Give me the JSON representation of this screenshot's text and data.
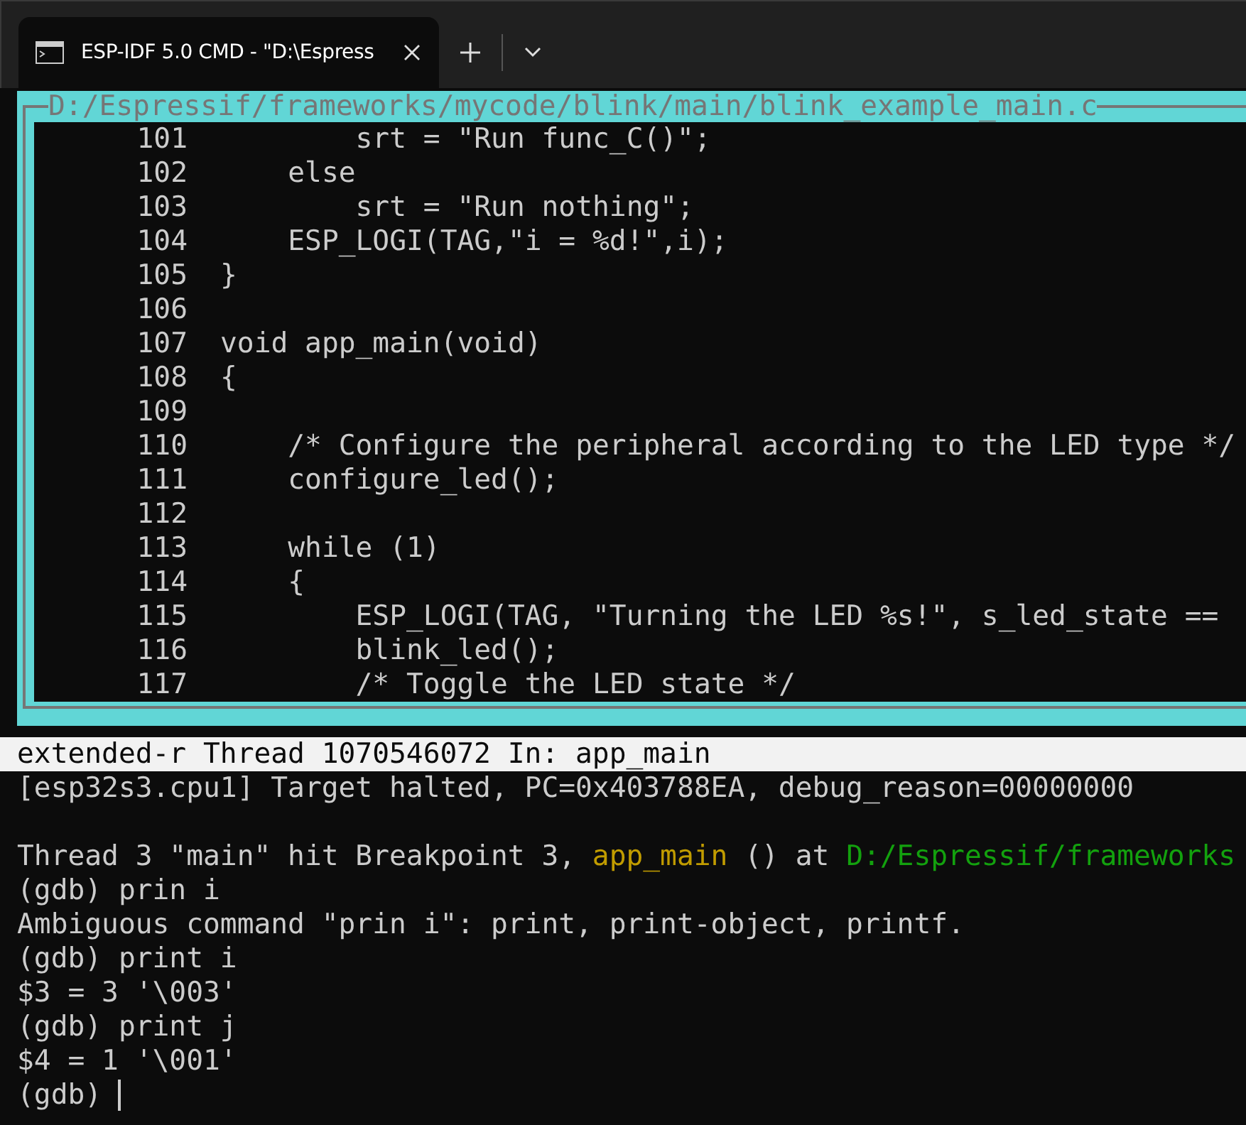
{
  "tab": {
    "title": "ESP-IDF 5.0 CMD - \"D:\\Espress",
    "selected": true
  },
  "editor": {
    "file_path": "D:/Espressif/frameworks/mycode/blink/main/blink_example_main.c",
    "lines": [
      {
        "number": "101",
        "code": "        srt = \"Run func_C()\";"
      },
      {
        "number": "102",
        "code": "    else"
      },
      {
        "number": "103",
        "code": "        srt = \"Run nothing\";"
      },
      {
        "number": "104",
        "code": "    ESP_LOGI(TAG,\"i = %d!\",i);"
      },
      {
        "number": "105",
        "code": "}"
      },
      {
        "number": "106"
      },
      {
        "number": "107",
        "code": "void app_main(void)"
      },
      {
        "number": "108",
        "code": "{"
      },
      {
        "number": "109"
      },
      {
        "number": "110",
        "code": "    /* Configure the peripheral according to the LED type */"
      },
      {
        "number": "111",
        "code": "    configure_led();"
      },
      {
        "number": "112"
      },
      {
        "number": "113",
        "code": "    while (1)"
      },
      {
        "number": "114",
        "code": "    {"
      },
      {
        "number": "115",
        "code": "        ESP_LOGI(TAG, \"Turning the LED %s!\", s_led_state =="
      },
      {
        "number": "116",
        "code": "        blink_led();"
      },
      {
        "number": "117",
        "code": "        /* Toggle the LED state */"
      }
    ]
  },
  "status_line": "extended-r Thread 1070546072 In: app_main",
  "output": [
    {
      "segments": [
        {
          "kind": "plain",
          "text": "[esp32s3.cpu1] Target halted, PC=0x403788EA, debug_reason=00000000"
        }
      ]
    },
    {
      "kind": "blank"
    },
    {
      "segments": [
        {
          "kind": "plain",
          "text": "Thread 3 \"main\" hit Breakpoint 3, "
        },
        {
          "kind": "function",
          "text": "app_main"
        },
        {
          "kind": "plain",
          "text": " () at "
        },
        {
          "kind": "path",
          "text": "D:/Espressif/frameworks"
        }
      ]
    },
    {
      "segments": [
        {
          "kind": "plain",
          "text": "(gdb) prin i"
        }
      ]
    },
    {
      "segments": [
        {
          "kind": "plain",
          "text": "Ambiguous command \"prin i\": print, print-object, printf."
        }
      ]
    },
    {
      "segments": [
        {
          "kind": "plain",
          "text": "(gdb) print i"
        }
      ]
    },
    {
      "segments": [
        {
          "kind": "plain",
          "text": "$3 = 3 '\\003'"
        }
      ]
    },
    {
      "segments": [
        {
          "kind": "plain",
          "text": "(gdb) print j"
        }
      ]
    },
    {
      "segments": [
        {
          "kind": "plain",
          "text": "$4 = 1 '\\001'"
        }
      ]
    }
  ],
  "prompt": {
    "text": "(gdb) ",
    "cursor": true
  }
}
